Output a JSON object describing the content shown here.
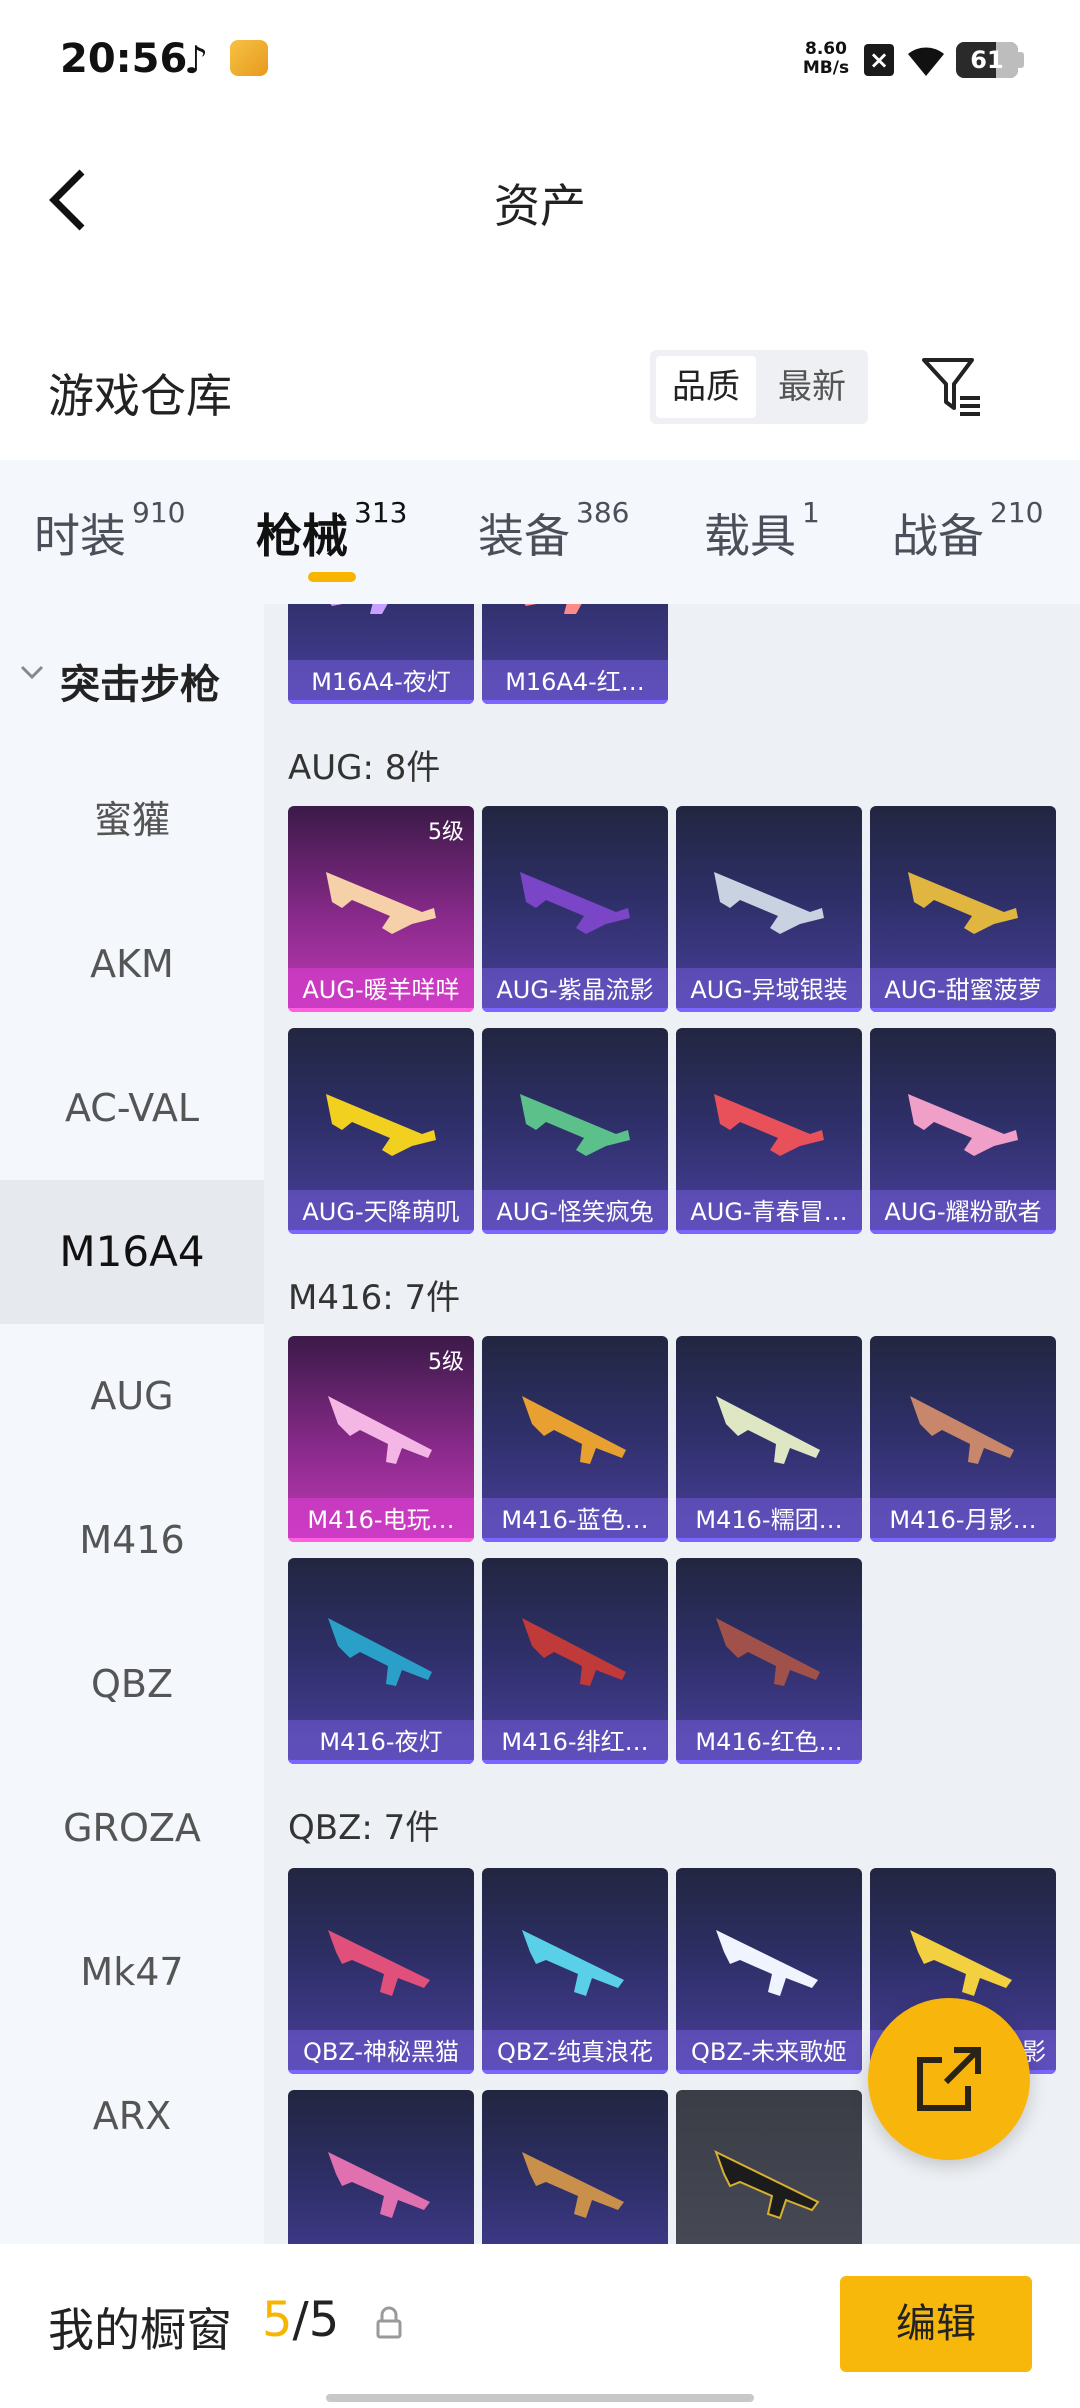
{
  "status_bar": {
    "time": "20:56",
    "net_speed_value": "8.60",
    "net_speed_unit": "MB/s",
    "battery": "61"
  },
  "nav": {
    "title": "资产"
  },
  "warehouse": {
    "title": "游戏仓库",
    "sort_options": [
      "品质",
      "最新"
    ]
  },
  "tabs": [
    {
      "label": "时装",
      "count": "910"
    },
    {
      "label": "枪械",
      "count": "313"
    },
    {
      "label": "装备",
      "count": "386"
    },
    {
      "label": "载具",
      "count": "1"
    },
    {
      "label": "战备",
      "count": "210"
    }
  ],
  "sidebar": {
    "group": "突击步枪",
    "items": [
      "蜜獾",
      "AKM",
      "AC-VAL",
      "M16A4",
      "AUG",
      "M416",
      "QBZ",
      "GROZA",
      "Mk47",
      "ARX"
    ],
    "active": "M16A4"
  },
  "content": {
    "m16_cards": [
      "M16A4-夜灯",
      "M16A4-红…"
    ],
    "aug": {
      "title": "AUG: 8件",
      "cards": [
        "AUG-暖羊咩咩",
        "AUG-紫晶流影",
        "AUG-异域银装",
        "AUG-甜蜜菠萝",
        "AUG-天降萌叽",
        "AUG-怪笑疯兔",
        "AUG-青春冒…",
        "AUG-耀粉歌者"
      ],
      "tier": "5级"
    },
    "m416": {
      "title": "M416: 7件",
      "cards": [
        "M416-电玩…",
        "M416-蓝色…",
        "M416-糯团…",
        "M416-月影…",
        "M416-夜灯",
        "M416-绯红…",
        "M416-红色…"
      ],
      "tier": "5级"
    },
    "qbz": {
      "title": "QBZ: 7件",
      "cards": [
        "QBZ-神秘黑猫",
        "QBZ-纯真浪花",
        "QBZ-未来歌姬",
        "影"
      ]
    }
  },
  "bottom": {
    "title": "我的橱窗",
    "used": "5",
    "total": "/5",
    "edit_label": "编辑"
  },
  "colors": {
    "accent": "#f7b500",
    "card_blue": "#4a3f9c",
    "card_gold": "#c13bb7"
  }
}
